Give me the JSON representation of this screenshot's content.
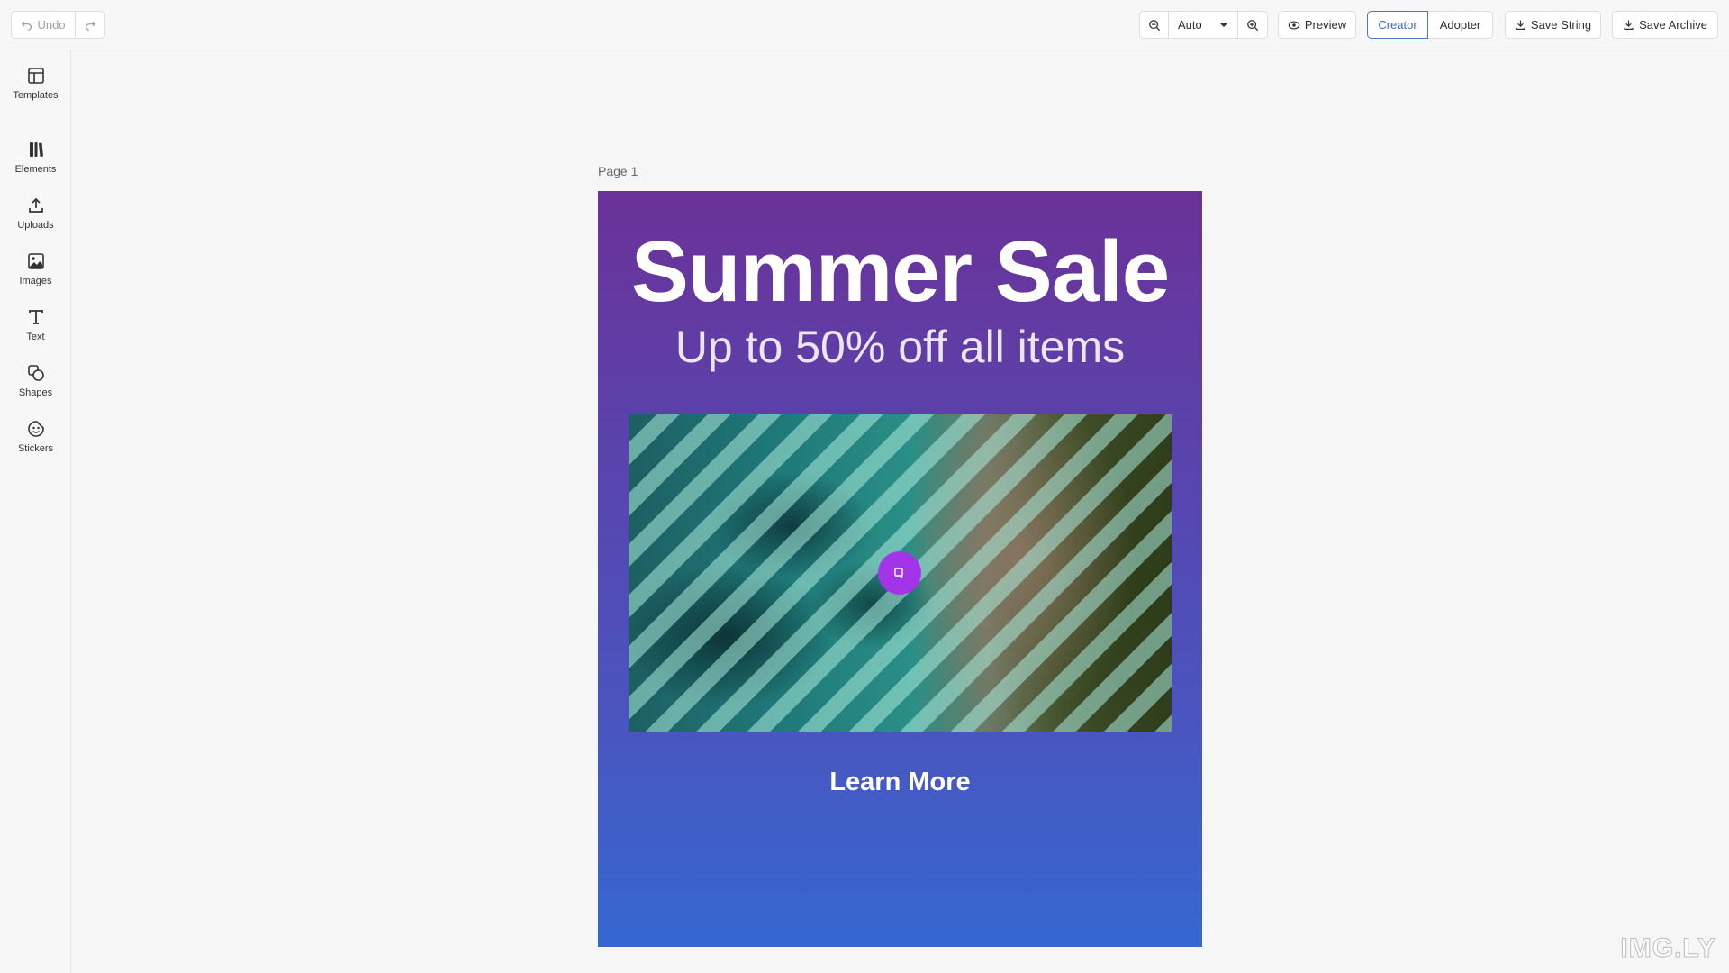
{
  "toolbar": {
    "undo_label": "Undo",
    "zoom_value": "Auto",
    "preview_label": "Preview",
    "creator_label": "Creator",
    "adopter_label": "Adopter",
    "save_string_label": "Save String",
    "save_archive_label": "Save Archive",
    "active_role": "Creator",
    "accent_color": "#3e6bbf"
  },
  "sidebar": {
    "items": [
      {
        "label": "Templates",
        "icon": "template-icon"
      },
      {
        "label": "Elements",
        "icon": "library-icon"
      },
      {
        "label": "Uploads",
        "icon": "upload-icon"
      },
      {
        "label": "Images",
        "icon": "image-icon"
      },
      {
        "label": "Text",
        "icon": "text-icon"
      },
      {
        "label": "Shapes",
        "icon": "shapes-icon"
      },
      {
        "label": "Stickers",
        "icon": "sticker-icon"
      }
    ]
  },
  "canvas": {
    "page_label": "Page 1",
    "headline": "Summer Sale",
    "subline": "Up to 50% off all items",
    "cta": "Learn More",
    "image_badge_icon": "replace-image-icon",
    "badge_color": "#a434e8",
    "gradient_top": "#6a3298",
    "gradient_bottom": "#3567d0"
  },
  "watermark": "IMG.LY"
}
